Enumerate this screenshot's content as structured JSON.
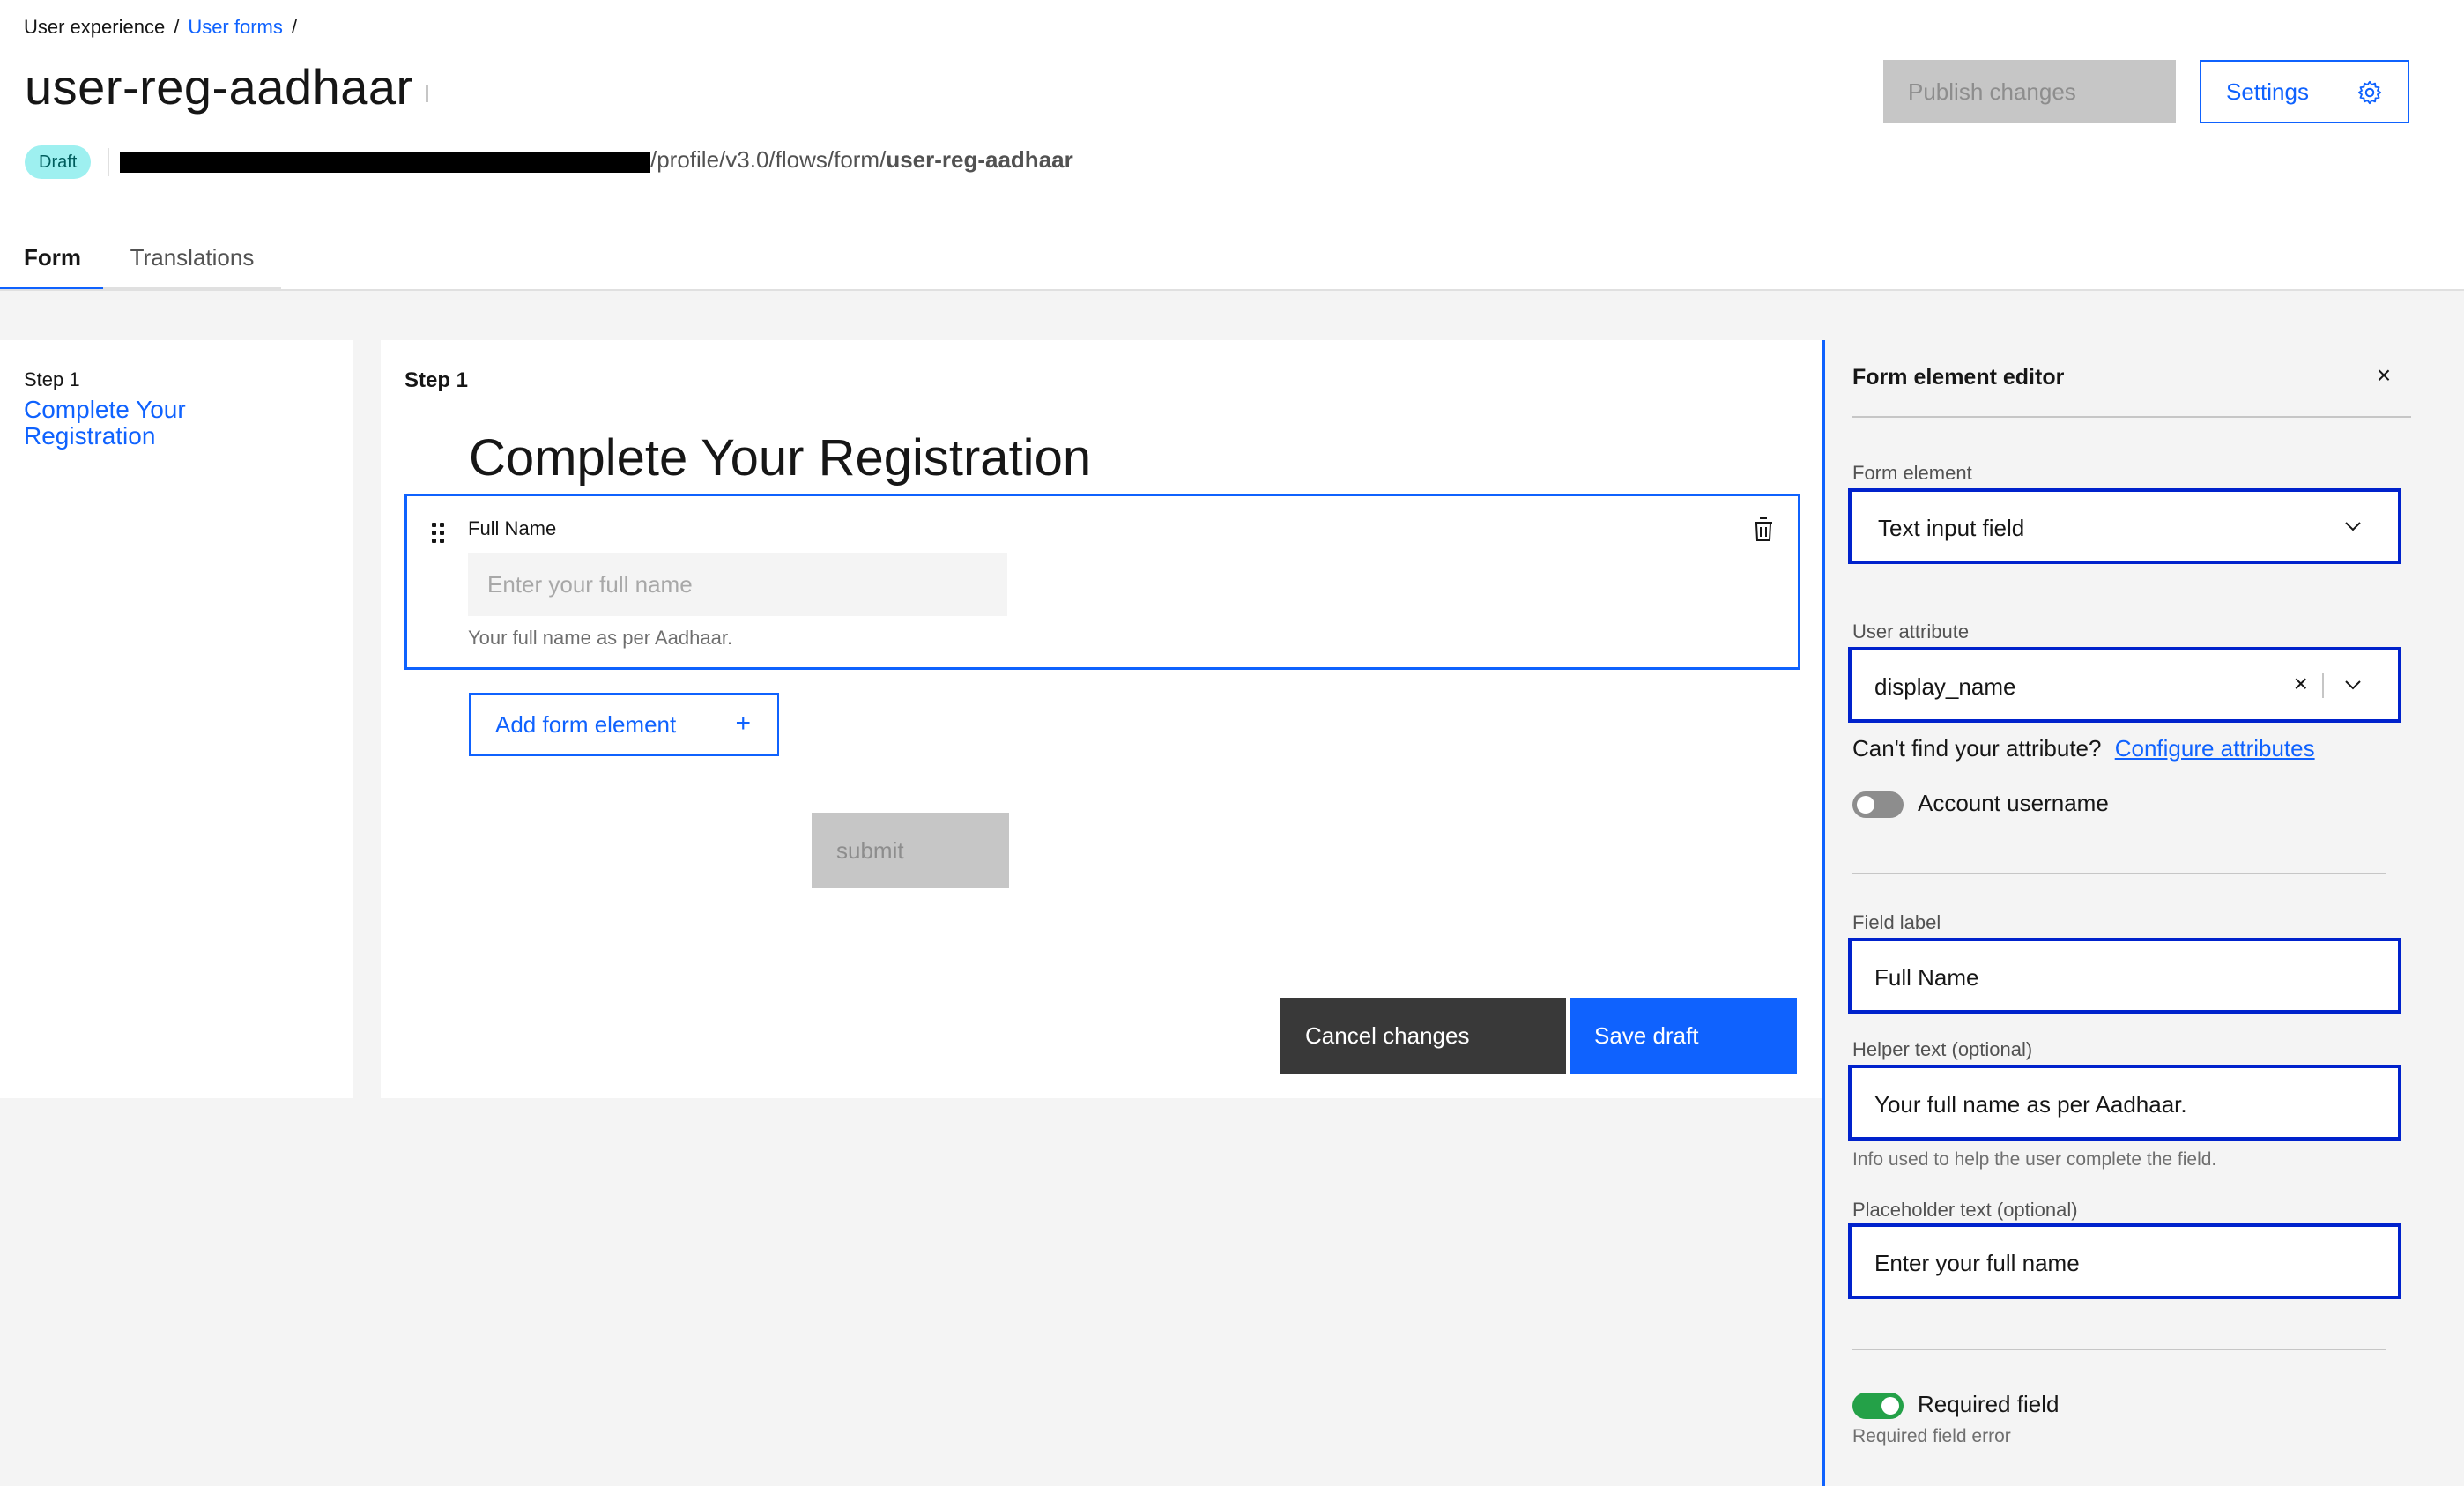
{
  "breadcrumb": {
    "root": "User experience",
    "sep1": "/",
    "link": "User forms",
    "sep2": "/"
  },
  "page": {
    "title": "user-reg-aadhaar",
    "status_tag": "Draft",
    "url_path": "/profile/v3.0/flows/form/",
    "url_name": "user-reg-aadhaar"
  },
  "toolbar": {
    "publish_label": "Publish changes",
    "settings_label": "Settings"
  },
  "tabs": [
    {
      "label": "Form"
    },
    {
      "label": "Translations"
    }
  ],
  "steps": {
    "label": "Step 1",
    "link": "Complete Your Registration"
  },
  "preview": {
    "step_label": "Step 1",
    "form_title": "Complete Your Registration",
    "field": {
      "label": "Full Name",
      "placeholder": "Enter your full name",
      "helper": "Your full name as per Aadhaar."
    },
    "add_label": "Add form element",
    "add_icon": "+",
    "submit_label": "submit",
    "cancel_label": "Cancel changes",
    "save_label": "Save draft"
  },
  "editor": {
    "title": "Form element editor",
    "close_icon": "×",
    "form_element_label": "Form element",
    "form_element_value": "Text input field",
    "user_attribute_label": "User attribute",
    "user_attribute_value": "display_name",
    "clear_icon": "×",
    "cant_find_text": "Can't find your attribute?",
    "configure_link": "Configure attributes",
    "account_username_label": "Account username",
    "field_label_label": "Field label",
    "field_label_value": "Full Name",
    "helper_label": "Helper text (optional)",
    "helper_value": "Your full name as per Aadhaar.",
    "helper_hint": "Info used to help the user complete the field.",
    "placeholder_label": "Placeholder text (optional)",
    "placeholder_value": "Enter your full name",
    "required_label": "Required field",
    "required_error_label": "Required field error"
  },
  "colors": {
    "accent": "#0f62fe",
    "highlight": "#0022cc",
    "success": "#24a148",
    "tag_bg": "#9ef0f0"
  }
}
